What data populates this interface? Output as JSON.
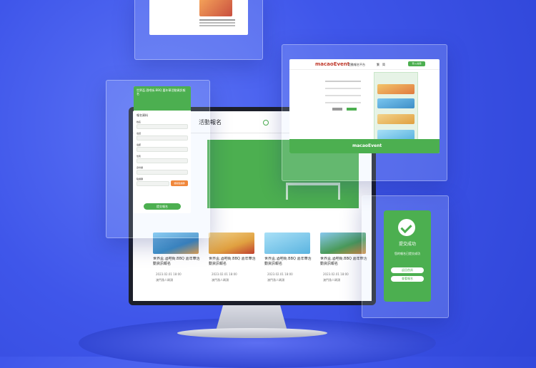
{
  "logo": "macaoEvent",
  "header": {
    "platform_title": "活動報名平台",
    "lang_options": [
      "繁",
      "简"
    ],
    "login_button": "登入/註冊"
  },
  "monitor": {
    "nav_title": "活動報名"
  },
  "events": [
    {
      "title": "世界盃.酒吧街.BBQ 嘉年華活動資訊報名",
      "date": "2023.02.01 18:00",
      "venue": "澳門漁人碼頭"
    },
    {
      "title": "世界盃.酒吧街.BBQ 嘉年華活動資訊報名",
      "date": "2023.02.01 18:00",
      "venue": "澳門漁人碼頭"
    },
    {
      "title": "世界盃.酒吧街.BBQ 嘉年華活動資訊報名",
      "date": "2023.02.01 18:00",
      "venue": "澳門漁人碼頭"
    },
    {
      "title": "世界盃.酒吧街.BBQ 嘉年華活動資訊報名",
      "date": "2023.02.01 18:00",
      "venue": "澳門漁人碼頭"
    }
  ],
  "form": {
    "header_title": "世界盃.酒吧街.BBQ 嘉年華活動資訊報名",
    "section": "報名資料",
    "fields": [
      "姓名",
      "電話",
      "電郵",
      "性別",
      "身份證",
      "驗證碼"
    ],
    "verify_button": "獲取驗證碼",
    "submit_button": "提交報名"
  },
  "success": {
    "title": "提交成功",
    "message": "您的報名已提交成功",
    "buttons": [
      "返回首頁",
      "查看報名"
    ]
  },
  "colors": {
    "accent": "#4caf50",
    "background": "#3f56ea"
  }
}
